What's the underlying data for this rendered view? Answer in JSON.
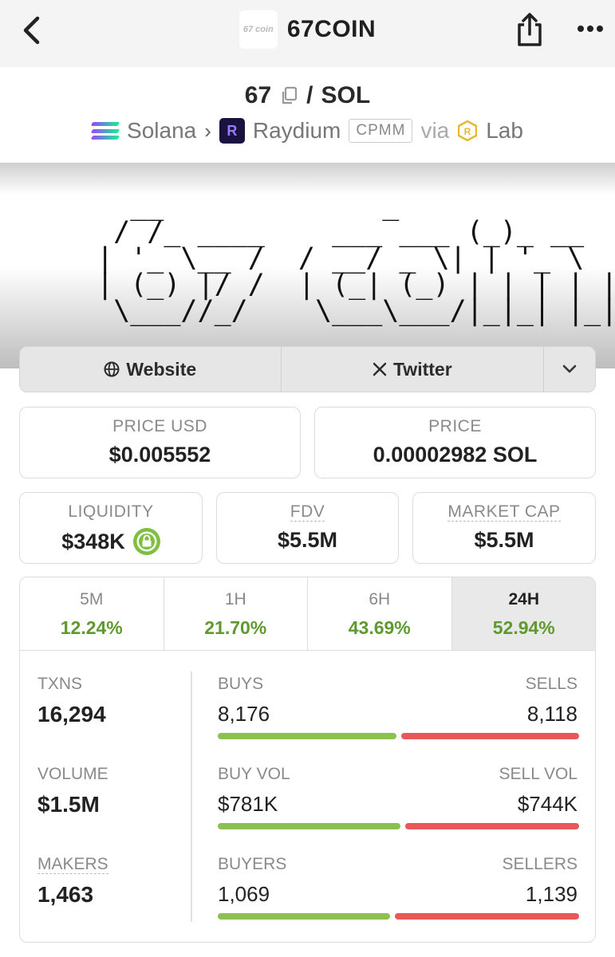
{
  "header": {
    "title": "67COIN",
    "logo_text": "67 coin"
  },
  "pair": {
    "base": "67",
    "separator": "/",
    "quote": "SOL"
  },
  "chain": {
    "network": "Solana",
    "dex": "Raydium",
    "pool_type": "CPMM",
    "via_label": "via",
    "launchpad": "Lab"
  },
  "banner": {
    "logo_text": "67 coin"
  },
  "links": {
    "website_label": "Website",
    "twitter_label": "Twitter"
  },
  "prices": {
    "usd_label": "PRICE USD",
    "usd_value": "$0.005552",
    "native_label": "PRICE",
    "native_value": "0.00002982 SOL"
  },
  "metrics": {
    "liquidity_label": "LIQUIDITY",
    "liquidity_value": "$348K",
    "fdv_label": "FDV",
    "fdv_value": "$5.5M",
    "mcap_label": "MARKET CAP",
    "mcap_value": "$5.5M"
  },
  "timeframes": [
    {
      "label": "5M",
      "change": "12.24%",
      "active": false
    },
    {
      "label": "1H",
      "change": "21.70%",
      "active": false
    },
    {
      "label": "6H",
      "change": "43.69%",
      "active": false
    },
    {
      "label": "24H",
      "change": "52.94%",
      "active": true
    }
  ],
  "stats": {
    "txns_label": "TXNS",
    "txns_value": "16,294",
    "volume_label": "VOLUME",
    "volume_value": "$1.5M",
    "makers_label": "MAKERS",
    "makers_value": "1,463",
    "rows": [
      {
        "left_label": "BUYS",
        "right_label": "SELLS",
        "left_value": "8,176",
        "right_value": "8,118",
        "buy_fraction": 0.502
      },
      {
        "left_label": "BUY VOL",
        "right_label": "SELL VOL",
        "left_value": "$781K",
        "right_value": "$744K",
        "buy_fraction": 0.512
      },
      {
        "left_label": "BUYERS",
        "right_label": "SELLERS",
        "left_value": "1,069",
        "right_value": "1,139",
        "buy_fraction": 0.484
      }
    ]
  },
  "colors": {
    "positive": "#5e9a2e",
    "buy_bar": "#8cc152",
    "sell_bar": "#e8575a",
    "lock_badge": "#7fbf3f"
  }
}
